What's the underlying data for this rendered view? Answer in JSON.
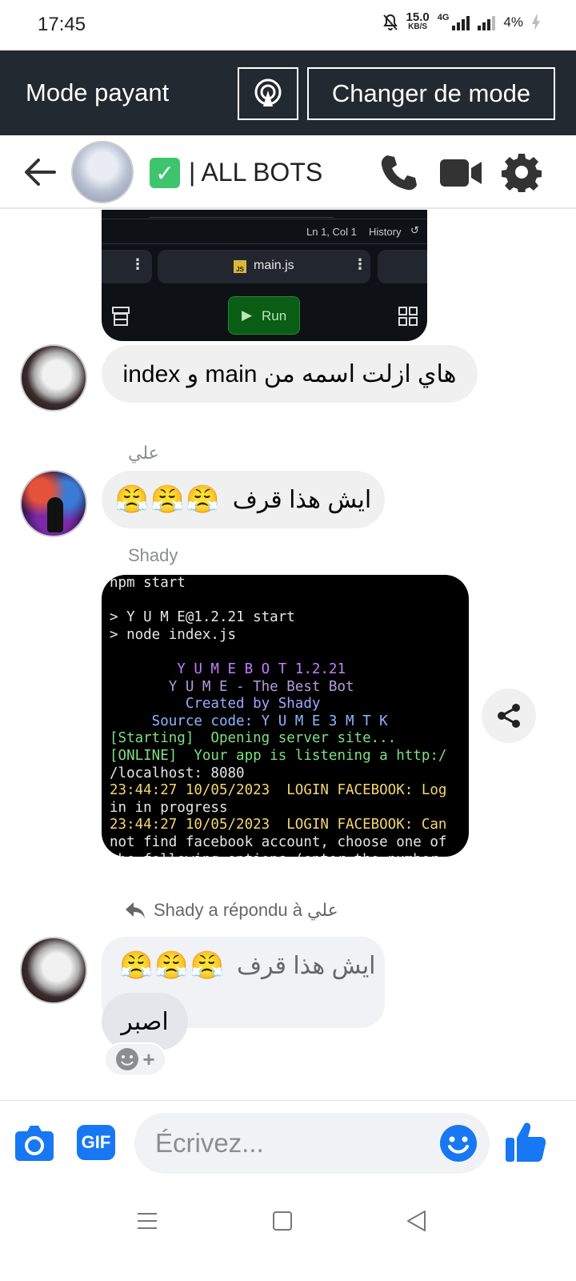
{
  "status_bar": {
    "time": "17:45",
    "net_speed": "15.0",
    "net_speed_unit": "KB/S",
    "network_type": "4G",
    "battery": "4%"
  },
  "mode_banner": {
    "title": "Mode payant",
    "switch_label": "Changer de mode"
  },
  "header": {
    "title": "| ALL BOTS",
    "badge_icon": "check-mark-icon"
  },
  "ide_screenshot": {
    "status_text": "Ln 1, Col 1",
    "history_label": "History",
    "file_tab": "main.js",
    "file_badge": "JS",
    "run_label": "Run"
  },
  "messages": [
    {
      "text": "هاي ازلت اسمه من main و index"
    },
    {
      "sender": "علي",
      "text": "ايش هذا قرف",
      "emojis": "😤😤😤"
    },
    {
      "sender": "Shady"
    }
  ],
  "terminal": {
    "lines": [
      {
        "text": "npm start",
        "color": "#e6e6e6"
      },
      {
        "text": "",
        "color": "#e6e6e6"
      },
      {
        "text": "> Y U M E@1.2.21 start",
        "color": "#e6e6e6"
      },
      {
        "text": "> node index.js",
        "color": "#e6e6e6"
      },
      {
        "text": "",
        "color": "#e6e6e6"
      },
      {
        "text": "        Y U M E B O T 1.2.21",
        "color": "#c77dff"
      },
      {
        "text": "       Y U M E - The Best Bot",
        "color": "#b39ddb"
      },
      {
        "text": "         Created by Shady",
        "color": "#9fa8ff"
      },
      {
        "text": "     Source code: Y U M E 3 M T K",
        "color": "#8fb4ff"
      },
      {
        "text": "[Starting]  Opening server site...",
        "color": "#7ee081"
      },
      {
        "text": "[ONLINE]  Your app is listening a http:/",
        "color": "#7ee081"
      },
      {
        "text": "/localhost: 8080",
        "color": "#e6e6e6"
      },
      {
        "text": "23:44:27 10/05/2023  LOGIN FACEBOOK: Log",
        "color": "#f5d76e"
      },
      {
        "text": "in in progress",
        "color": "#e6e6e6"
      },
      {
        "text": "23:44:27 10/05/2023  LOGIN FACEBOOK: Can",
        "color": "#f5d76e"
      },
      {
        "text": "not find facebook account, choose one of",
        "color": "#e6e6e6"
      },
      {
        "text": "the following options (enter the number",
        "color": "#e6e6e6"
      }
    ]
  },
  "reply": {
    "note": "Shady a répondu à علي",
    "quoted_text": "ايش هذا قرف",
    "quoted_emojis": "😤😤😤",
    "reply_text": "اصبر"
  },
  "composer": {
    "placeholder": "Écrivez...",
    "gif_label": "GIF"
  },
  "colors": {
    "brand_blue": "#1877f2",
    "banner_bg": "#232931",
    "bubble_bg": "#f0f0f0"
  }
}
